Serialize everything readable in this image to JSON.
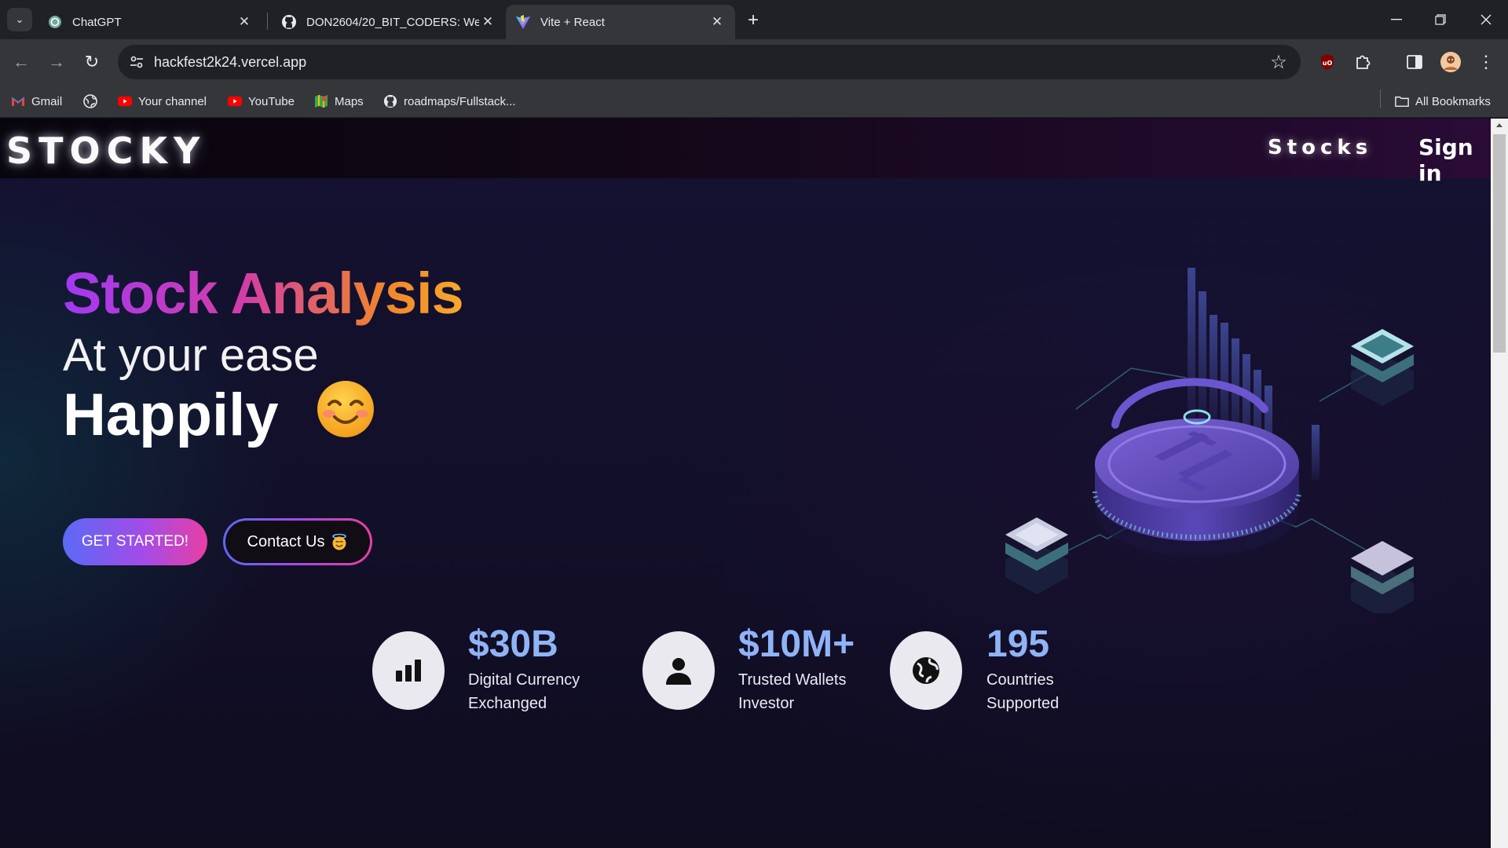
{
  "browser": {
    "tabs": [
      {
        "title": "ChatGPT",
        "active": false
      },
      {
        "title": "DON2604/20_BIT_CODERS: We",
        "active": false
      },
      {
        "title": "Vite + React",
        "active": true
      }
    ],
    "url": "hackfest2k24.vercel.app",
    "bookmarks": [
      "Gmail",
      "",
      "Your channel",
      "YouTube",
      "Maps",
      "roadmaps/Fullstack..."
    ],
    "all_bookmarks": "All Bookmarks"
  },
  "header": {
    "logo": "STOCKY",
    "nav_stocks": "Stocks",
    "nav_signin": "Sign in"
  },
  "hero": {
    "title": "Stock Analysis",
    "line2": "At your ease",
    "line3": "Happily",
    "get_started": "GET STARTED!",
    "contact": "Contact Us"
  },
  "stats": [
    {
      "value": "$30B",
      "label1": "Digital Currency",
      "label2": "Exchanged",
      "icon": "bar-chart-icon"
    },
    {
      "value": "$10M+",
      "label1": "Trusted Wallets",
      "label2": "Investor",
      "icon": "person-icon"
    },
    {
      "value": "195",
      "label1": "Countries",
      "label2": "Supported",
      "icon": "globe-icon"
    }
  ],
  "colors": {
    "accent_blue": "#8fb4f6",
    "gradient_start": "#a239f5",
    "gradient_end": "#f7a92a",
    "button_start": "#5b6af5",
    "button_end": "#e83fa4"
  }
}
